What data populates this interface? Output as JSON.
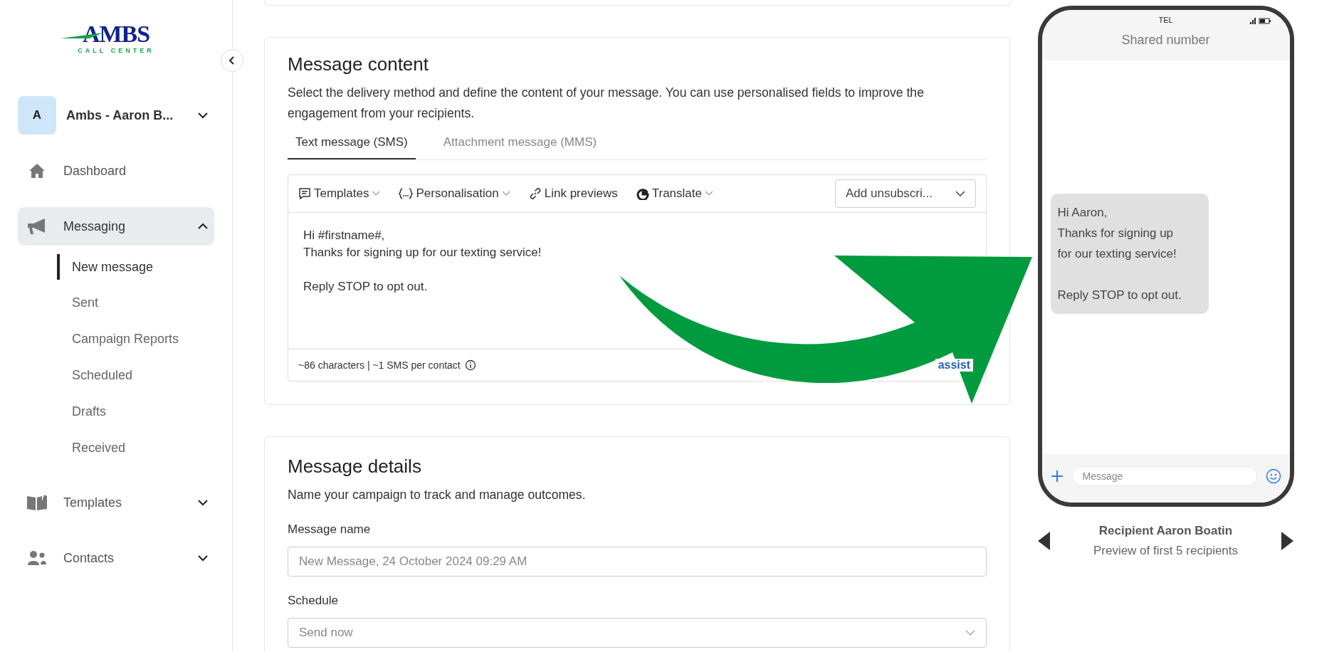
{
  "logo": {
    "name": "AMBS",
    "tagline": "CALL CENTER"
  },
  "account": {
    "initial": "A",
    "name": "Ambs - Aaron B..."
  },
  "nav": [
    {
      "label": "Dashboard",
      "kind": "link",
      "selected": false
    },
    {
      "label": "Messaging",
      "kind": "group",
      "selected": true,
      "expanded": true,
      "children": [
        {
          "label": "New message",
          "selected": true
        },
        {
          "label": "Sent",
          "selected": false
        },
        {
          "label": "Campaign Reports",
          "selected": false
        },
        {
          "label": "Scheduled",
          "selected": false
        },
        {
          "label": "Drafts",
          "selected": false
        },
        {
          "label": "Received",
          "selected": false
        }
      ]
    },
    {
      "label": "Templates",
      "kind": "group",
      "selected": false,
      "expanded": false
    },
    {
      "label": "Contacts",
      "kind": "group",
      "selected": false,
      "expanded": false
    }
  ],
  "message_content": {
    "title": "Message content",
    "description": "Select the delivery method and define the content of your message. You can use personalised fields to improve the engagement from your recipients.",
    "tabs": [
      {
        "label": "Text message (SMS)",
        "selected": true
      },
      {
        "label": "Attachment message (MMS)",
        "selected": false
      }
    ],
    "toolbar": [
      {
        "label": "Templates",
        "dropdown": true
      },
      {
        "label": "Personalisation",
        "dropdown": true
      },
      {
        "label": "Link previews",
        "dropdown": false
      },
      {
        "label": "Translate",
        "dropdown": true
      }
    ],
    "unsubscribe_select": "Add unsubscri...",
    "editor_text": "Hi #firstname#,\nThanks for signing up for our texting service!\n\nReply STOP to opt out.",
    "counter": "~86 characters | ~1 SMS per contact",
    "assistant_link": "assist"
  },
  "message_details": {
    "title": "Message details",
    "description": "Name your campaign to track and manage outcomes.",
    "fields": [
      {
        "label": "Message name",
        "placeholder": "New Message, 24 October 2024 09:29 AM",
        "kind": "text"
      },
      {
        "label": "Schedule",
        "placeholder": "Send now",
        "kind": "select"
      }
    ]
  },
  "phone": {
    "carrier": "TEL",
    "header": "Shared number",
    "bubble": "Hi Aaron,\nThanks for signing up\nfor our texting service!\n\nReply STOP to opt out.",
    "input_placeholder": "Message"
  },
  "preview": {
    "recipient": "Recipient Aaron Boatin",
    "note": "Preview of first 5 recipients"
  }
}
